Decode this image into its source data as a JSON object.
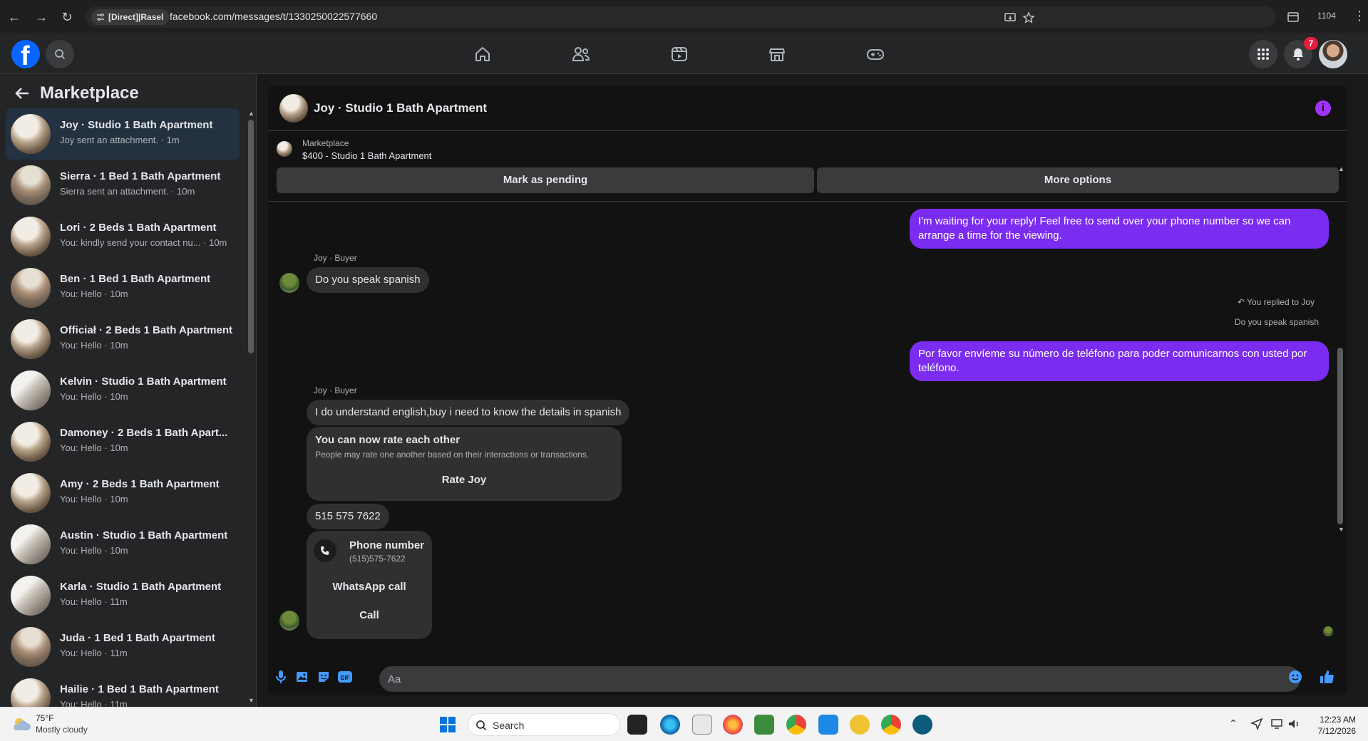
{
  "browser": {
    "site_chip": "[Direct]|Rasel",
    "url": "facebook.com/messages/t/1330250022577660",
    "profile_count": "1104"
  },
  "fb_nav": {
    "logo": "f",
    "notification_count": "7",
    "tabs": [
      "home-icon",
      "friends-icon",
      "watch-icon",
      "marketplace-icon",
      "gaming-icon"
    ]
  },
  "sidebar": {
    "title": "Marketplace",
    "conversations": [
      {
        "name": "Joy · Studio 1 Bath Apartment",
        "preview": "Joy sent an attachment. · 1m"
      },
      {
        "name": "Sierra · 1 Bed 1 Bath Apartment",
        "preview": "Sierra sent an attachment. · 10m"
      },
      {
        "name": "Lori · 2 Beds 1 Bath Apartment",
        "preview": "You: kindly send your contact nu... · 10m"
      },
      {
        "name": "Ben · 1 Bed 1 Bath Apartment",
        "preview": "You: Hello · 10m"
      },
      {
        "name": "Officiał · 2 Beds 1 Bath Apartment",
        "preview": "You: Hello · 10m"
      },
      {
        "name": "Kelvin · Studio 1 Bath Apartment",
        "preview": "You: Hello · 10m"
      },
      {
        "name": "Damoney · 2 Beds 1 Bath Apart...",
        "preview": "You: Hello · 10m"
      },
      {
        "name": "Amy · 2 Beds 1 Bath Apartment",
        "preview": "You: Hello · 10m"
      },
      {
        "name": "Austin · Studio 1 Bath Apartment",
        "preview": "You: Hello · 10m"
      },
      {
        "name": "Karla · Studio 1 Bath Apartment",
        "preview": "You: Hello · 11m"
      },
      {
        "name": "Juda · 1 Bed 1 Bath Apartment",
        "preview": "You: Hello · 11m"
      },
      {
        "name": "Hailie · 1 Bed 1 Bath Apartment",
        "preview": "You: Hello · 11m"
      }
    ]
  },
  "chat": {
    "title": "Joy · Studio 1 Bath Apartment",
    "listing_label": "Marketplace",
    "listing_title": "$400 - Studio 1 Bath Apartment",
    "mark_pending": "Mark as pending",
    "more_options": "More options",
    "messages": {
      "out1": "I'm waiting for your reply! Feel free to send over your phone number so we can arrange a time for the viewing.",
      "sender1": "Joy · Buyer",
      "in1": "Do you speak spanish",
      "reply_meta": "You replied to Joy",
      "reply_quote": "Do you speak spanish",
      "out2": "Por favor envíeme su número de teléfono para poder comunicarnos con usted por teléfono.",
      "sender2": "Joy · Buyer",
      "in2": "I do understand english,buy i need to know the details in spanish",
      "rate_title": "You can now rate each other",
      "rate_text": "People may rate one another based on their interactions or transactions.",
      "rate_button": "Rate Joy",
      "in3": "515 575 7622",
      "phone_title": "Phone number",
      "phone_value": "(515)575-7622",
      "whatsapp_button": "WhatsApp call",
      "call_button": "Call"
    },
    "composer_placeholder": "Aa"
  },
  "taskbar": {
    "weather_temp": "75°F",
    "weather_desc": "Mostly cloudy",
    "search": "Search",
    "time": "12:23 AM",
    "date": "7/12/2026"
  },
  "colors": {
    "accent": "#0866ff",
    "outgoing_bubble": "#7a2cf0",
    "info": "#a033ff",
    "badge": "#e41e3f"
  }
}
